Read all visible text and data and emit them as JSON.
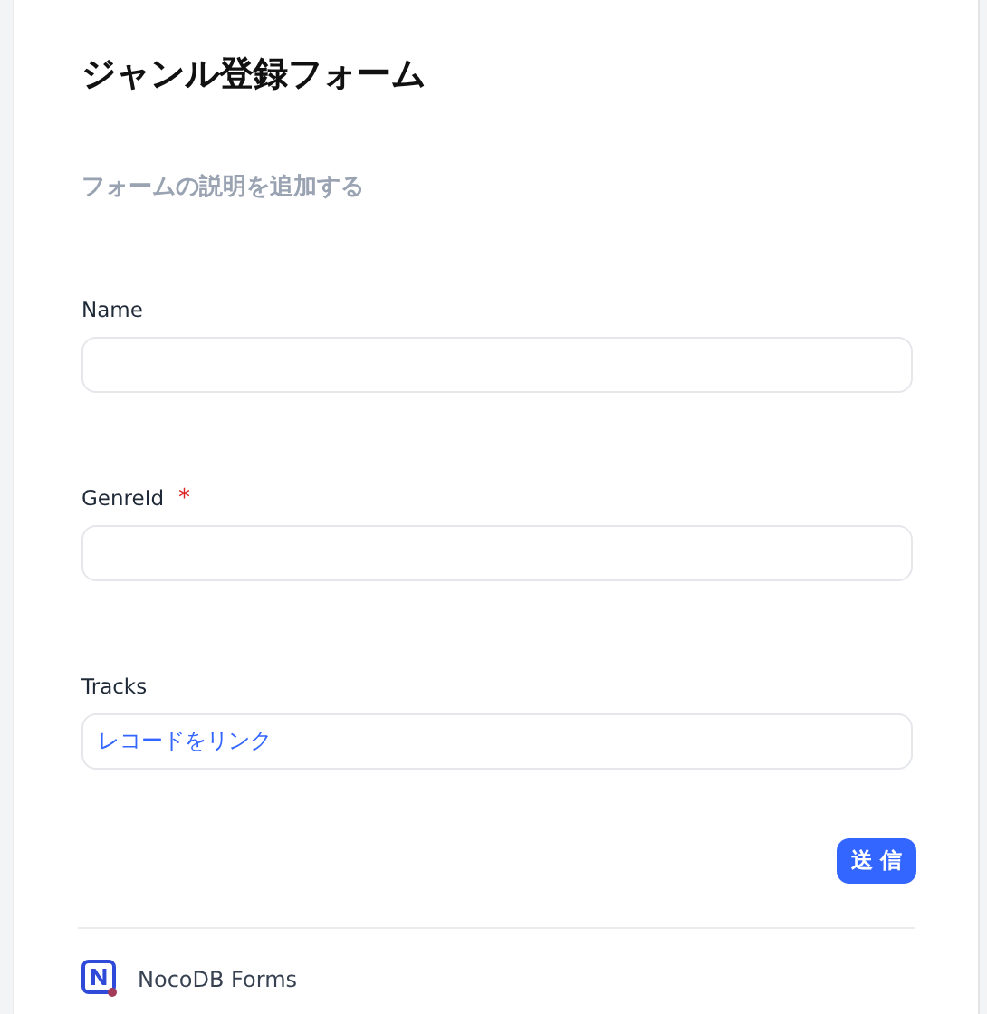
{
  "form": {
    "title": "ジャンル登録フォーム",
    "description_placeholder": "フォームの説明を追加する"
  },
  "fields": [
    {
      "label": "Name",
      "kind": "text"
    },
    {
      "label": "GenreId",
      "required_mark": "*",
      "kind": "text"
    },
    {
      "label": "Tracks",
      "kind": "link",
      "link_text": "レコードをリンク"
    }
  ],
  "submit_button": "送 信",
  "footer": {
    "brand": "NocoDB Forms"
  }
}
